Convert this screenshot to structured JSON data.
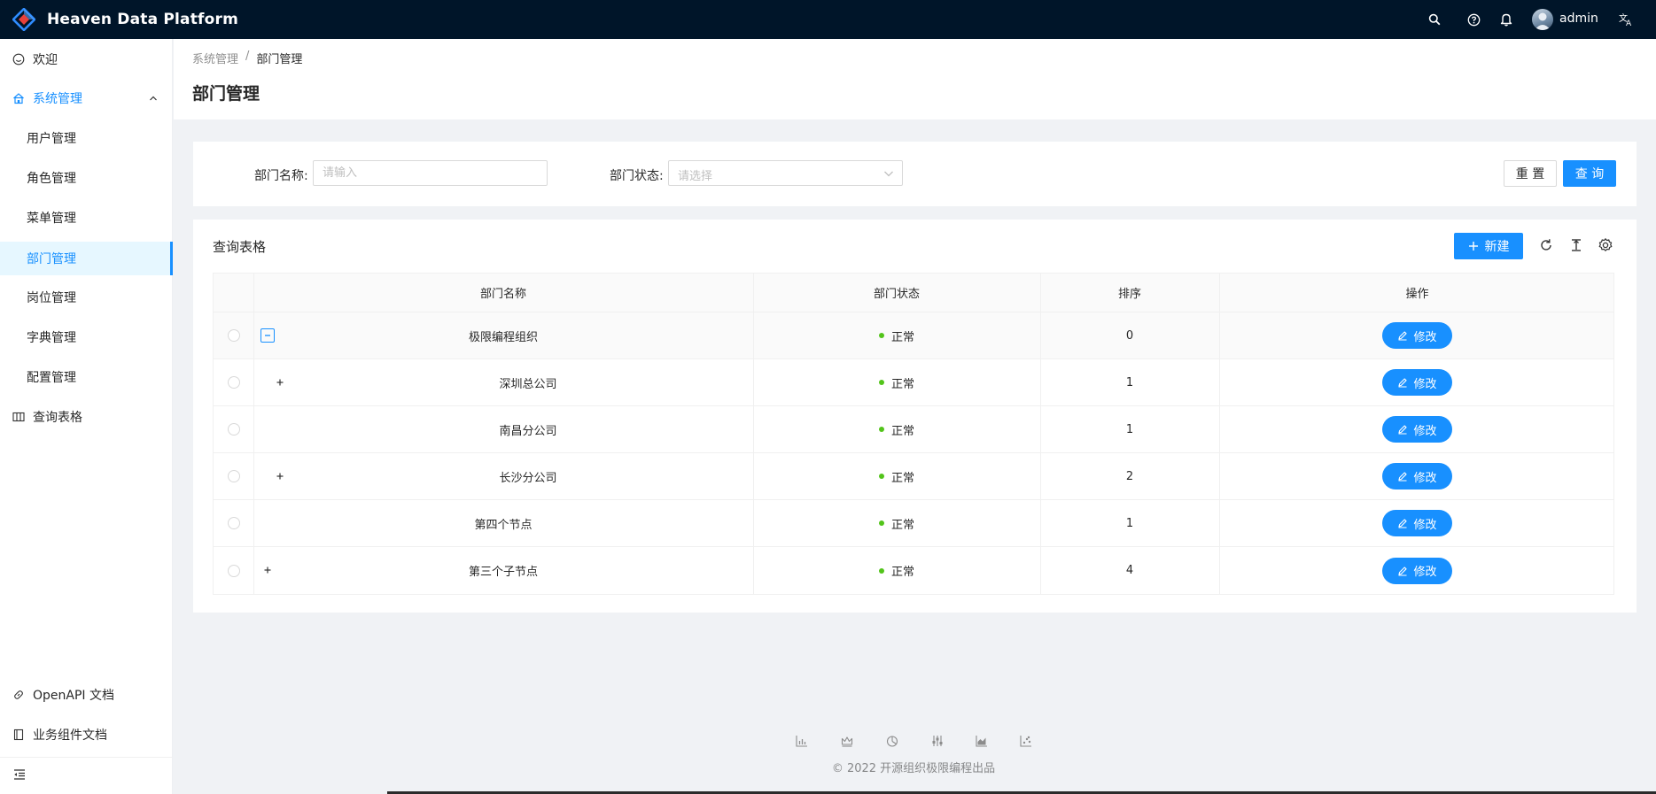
{
  "app": {
    "title": "Heaven Data Platform",
    "username": "admin",
    "accent": "#1890ff",
    "header_bg": "#001529"
  },
  "sidebar": {
    "items": [
      {
        "label": "欢迎",
        "icon": "smile-icon"
      },
      {
        "label": "系统管理",
        "icon": "home-icon",
        "expanded": true
      },
      {
        "label": "用户管理"
      },
      {
        "label": "角色管理"
      },
      {
        "label": "菜单管理"
      },
      {
        "label": "部门管理",
        "active": true
      },
      {
        "label": "岗位管理"
      },
      {
        "label": "字典管理"
      },
      {
        "label": "配置管理"
      },
      {
        "label": "查询表格",
        "icon": "table-icon"
      }
    ],
    "bottom_items": [
      {
        "label": "OpenAPI 文档",
        "icon": "link-icon"
      },
      {
        "label": "业务组件文档",
        "icon": "book-icon"
      }
    ]
  },
  "breadcrumb": [
    "系统管理",
    "/",
    "部门管理"
  ],
  "page_title": "部门管理",
  "search": {
    "name_label": "部门名称:",
    "name_placeholder": "请输入",
    "name_value": "",
    "status_label": "部门状态:",
    "status_placeholder": "请选择",
    "reset_label": "重 置",
    "query_label": "查 询"
  },
  "table": {
    "title": "查询表格",
    "new_label": "新建",
    "columns": [
      "部门名称",
      "部门状态",
      "排序",
      "操作"
    ],
    "rows": [
      {
        "name": "极限编程组织",
        "status": "正常",
        "order": "0",
        "action": "修改",
        "expander": "minus",
        "indent": 0
      },
      {
        "name": "深圳总公司",
        "status": "正常",
        "order": "1",
        "action": "修改",
        "expander": "plus",
        "indent": 1
      },
      {
        "name": "南昌分公司",
        "status": "正常",
        "order": "1",
        "action": "修改",
        "expander": "none",
        "indent": 1
      },
      {
        "name": "长沙分公司",
        "status": "正常",
        "order": "2",
        "action": "修改",
        "expander": "plus",
        "indent": 1
      },
      {
        "name": "第四个节点",
        "status": "正常",
        "order": "1",
        "action": "修改",
        "expander": "none",
        "indent": 0
      },
      {
        "name": "第三个子节点",
        "status": "正常",
        "order": "4",
        "action": "修改",
        "expander": "plus",
        "indent": 0
      }
    ]
  },
  "footer": {
    "copyright": "2022 开源组织极限编程出品"
  }
}
